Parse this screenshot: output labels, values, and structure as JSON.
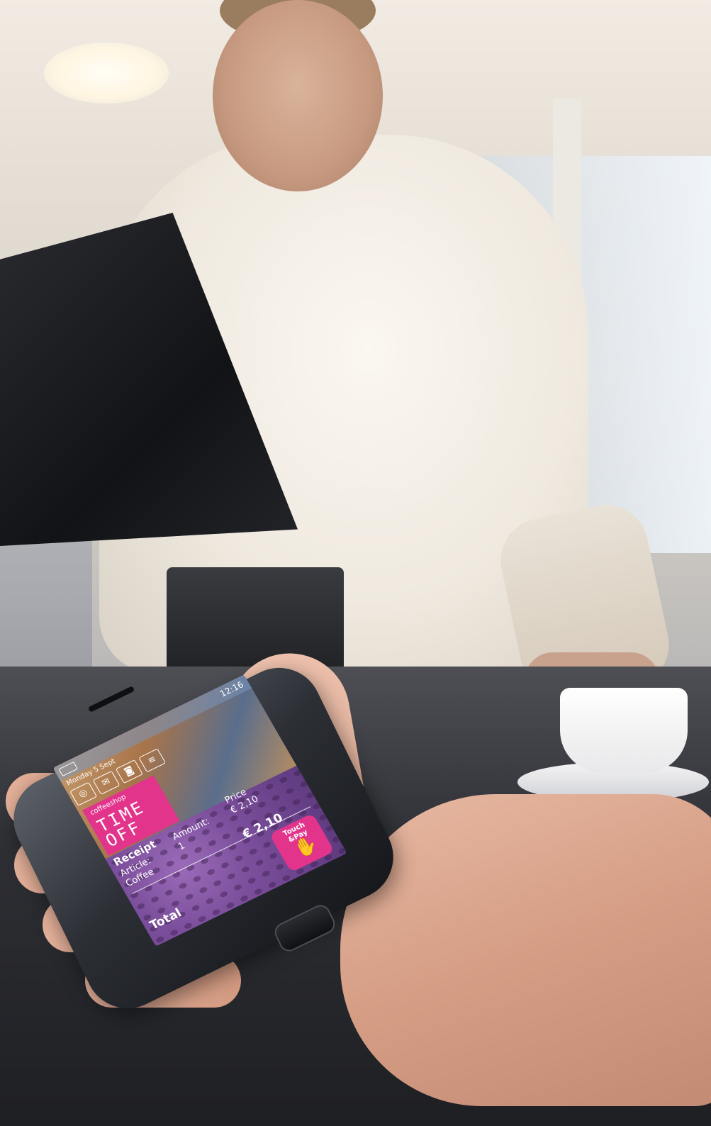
{
  "phone": {
    "status": {
      "time": "12:16"
    },
    "date": "Monday 5 Sept",
    "brand": {
      "small": "coffeeshop",
      "big_line1": "TIME",
      "big_line2": "OFF"
    },
    "receipt": {
      "title": "Receipt",
      "article_label": "Article:",
      "article_value": "Coffee",
      "amount_label": "Amount:",
      "amount_value": "1",
      "price_label": "Price",
      "price_value": "€ 2,10",
      "total_label": "Total",
      "total_value": "€ 2,10"
    },
    "touch_pay": {
      "line1": "Touch",
      "line2": "&Pay"
    }
  },
  "colors": {
    "brand_pink": "#e3348c",
    "receipt_purple": "#7c4f9c"
  },
  "icons": [
    "globe-icon",
    "mail-icon",
    "camera-icon",
    "note-icon",
    "hand-icon"
  ]
}
